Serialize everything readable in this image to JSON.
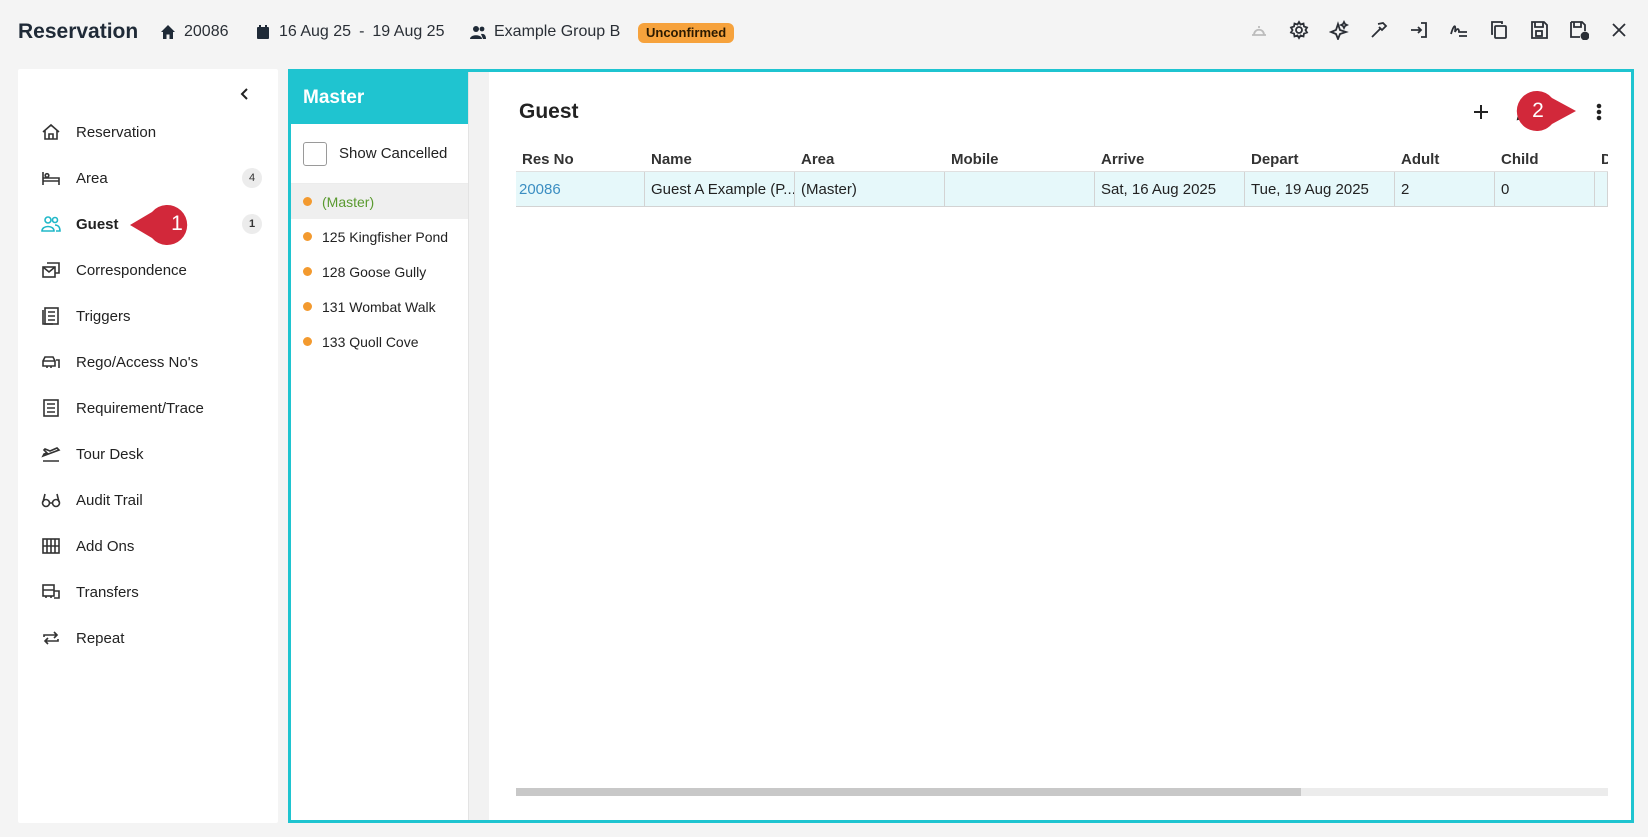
{
  "header": {
    "title": "Reservation",
    "res_no": "20086",
    "date_from": "16 Aug 25",
    "date_sep": "-",
    "date_to": "19 Aug 25",
    "group": "Example Group B",
    "status": "Unconfirmed"
  },
  "header_tools": [
    "bell-icon",
    "gear-icon",
    "sparkle-icon",
    "hammer-icon",
    "sign-in-icon",
    "signature-icon",
    "copy-icon",
    "save-icon",
    "save-close-icon",
    "close-icon"
  ],
  "sidebar": {
    "items": [
      {
        "label": "Reservation",
        "icon": "home-icon"
      },
      {
        "label": "Area",
        "icon": "bed-icon",
        "count": "4"
      },
      {
        "label": "Guest",
        "icon": "users-icon",
        "count": "1",
        "active": true
      },
      {
        "label": "Correspondence",
        "icon": "mail-icon"
      },
      {
        "label": "Triggers",
        "icon": "list-icon"
      },
      {
        "label": "Rego/Access No's",
        "icon": "car-icon"
      },
      {
        "label": "Requirement/Trace",
        "icon": "checklist-icon"
      },
      {
        "label": "Tour Desk",
        "icon": "plane-icon"
      },
      {
        "label": "Audit Trail",
        "icon": "glasses-icon"
      },
      {
        "label": "Add Ons",
        "icon": "grid-icon"
      },
      {
        "label": "Transfers",
        "icon": "bus-icon"
      },
      {
        "label": "Repeat",
        "icon": "repeat-icon"
      }
    ]
  },
  "master": {
    "title": "Master",
    "show_cancelled": "Show Cancelled",
    "areas": [
      "(Master)",
      "125 Kingfisher Pond",
      "128 Goose Gully",
      "131 Wombat Walk",
      "133 Quoll Cove"
    ]
  },
  "guest": {
    "title": "Guest",
    "columns": [
      "Res No",
      "Name",
      "Area",
      "Mobile",
      "Arrive",
      "Depart",
      "Adult",
      "Child",
      "D"
    ],
    "rows": [
      [
        "20086",
        "Guest A Example (P...",
        "(Master)",
        "",
        "Sat, 16 Aug 2025",
        "Tue, 19 Aug 2025",
        "2",
        "0",
        ""
      ]
    ]
  },
  "callouts": [
    "1",
    "2"
  ],
  "colors": {
    "accent": "#1fc4d0",
    "status": "#f6a23c",
    "callout": "#d2283a",
    "selected_text": "#5a9a2f"
  }
}
